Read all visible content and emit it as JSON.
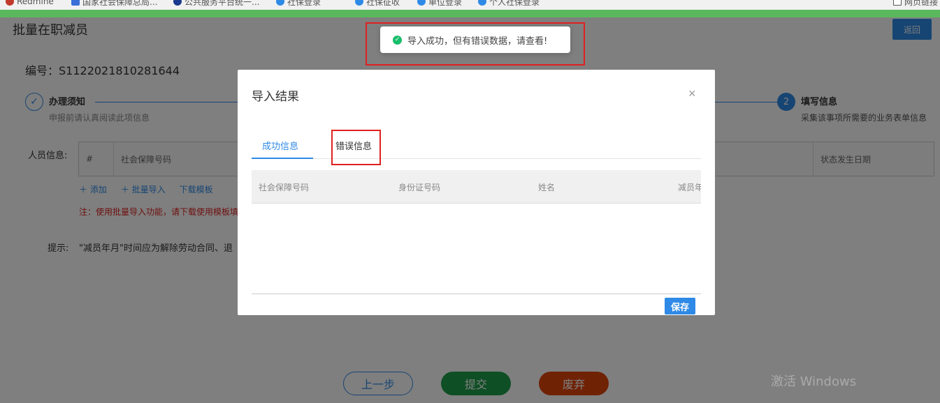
{
  "browser": {
    "bookmarks": [
      {
        "label": "Redmine",
        "color": "#c0392b"
      },
      {
        "label": "国家社会保障总局...",
        "color": "#3a6fd8"
      },
      {
        "label": "公共服务平台统一...",
        "color": "#1a3a8f"
      },
      {
        "label": "社保登录",
        "color": "#2e8ae6"
      },
      {
        "label": "社保征收",
        "color": "#2e8ae6"
      },
      {
        "label": "单位登录",
        "color": "#2e8ae6"
      },
      {
        "label": "个人社保登录",
        "color": "#2e8ae6"
      },
      {
        "label": "网页链接",
        "color": "#555"
      }
    ]
  },
  "page": {
    "title": "批量在职减员",
    "back_label": "返回",
    "serial": "编号：S1122021810281644",
    "steps": {
      "step1": {
        "icon": "✓",
        "title": "办理须知",
        "desc": "申报前请认真阅读此项信息"
      },
      "step2": {
        "number": "2",
        "title": "填写信息",
        "desc": "采集该事项所需要的业务表单信息"
      }
    },
    "person_label": "人员信息:",
    "person_table": {
      "col_index": "#",
      "col_ssn": "社会保障号码",
      "col_date": "状态发生日期"
    },
    "actions": {
      "add": "＋ 添加",
      "batch_import": "＋ 批量导入",
      "download_template": "下载模板"
    },
    "note": "注：使用批量导入功能，请下载使用模板填写",
    "tip_label": "提示:",
    "tip_text": "\"减员年月\"时间应为解除劳动合同、退",
    "buttons": {
      "prev": "上一步",
      "submit": "提交",
      "discard": "废弃"
    },
    "watermark": "激活 Windows"
  },
  "toast": {
    "message": "导入成功，但有错误数据，请查看!"
  },
  "modal": {
    "title": "导入结果",
    "close_icon": "×",
    "tabs": {
      "success": "成功信息",
      "error": "错误信息"
    },
    "table_headers": {
      "ssn": "社会保障号码",
      "id_number": "身份证号码",
      "name": "姓名",
      "reduce_month": "减员年月"
    },
    "save_label": "保存"
  },
  "colors": {
    "primary": "#2e8ae6",
    "submit": "#1e9e4a",
    "discard": "#e0450b",
    "highlight": "#e02020",
    "success": "#19be6b"
  }
}
